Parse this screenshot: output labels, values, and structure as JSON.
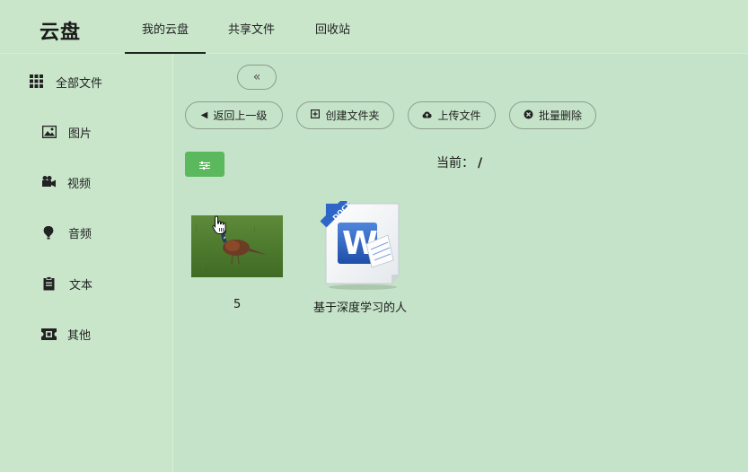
{
  "app": {
    "brand": "云盘"
  },
  "nav": {
    "tabs": [
      {
        "label": "我的云盘",
        "active": true
      },
      {
        "label": "共享文件",
        "active": false
      },
      {
        "label": "回收站",
        "active": false
      }
    ]
  },
  "sidebar": {
    "items": [
      {
        "label": "全部文件",
        "icon": "grid-icon"
      },
      {
        "label": "图片",
        "icon": "image-icon"
      },
      {
        "label": "视频",
        "icon": "video-camera-icon"
      },
      {
        "label": "音频",
        "icon": "music-note-icon"
      },
      {
        "label": "文本",
        "icon": "clipboard-icon"
      },
      {
        "label": "其他",
        "icon": "ticket-icon"
      }
    ]
  },
  "toolbar": {
    "collapse_label": "«",
    "back_label": "返回上一级",
    "create_folder_label": "创建文件夹",
    "upload_label": "上传文件",
    "batch_delete_label": "批量删除"
  },
  "breadcrumb": {
    "prefix": "当前：",
    "path": "/"
  },
  "files": [
    {
      "name": "5",
      "type": "image"
    },
    {
      "name": "基于深度学习的人",
      "type": "docx",
      "badge": "DOCX"
    }
  ],
  "colors": {
    "background": "#c5e3c8",
    "filter_button": "#5cb85c",
    "word_blue": "#2b62c4"
  }
}
